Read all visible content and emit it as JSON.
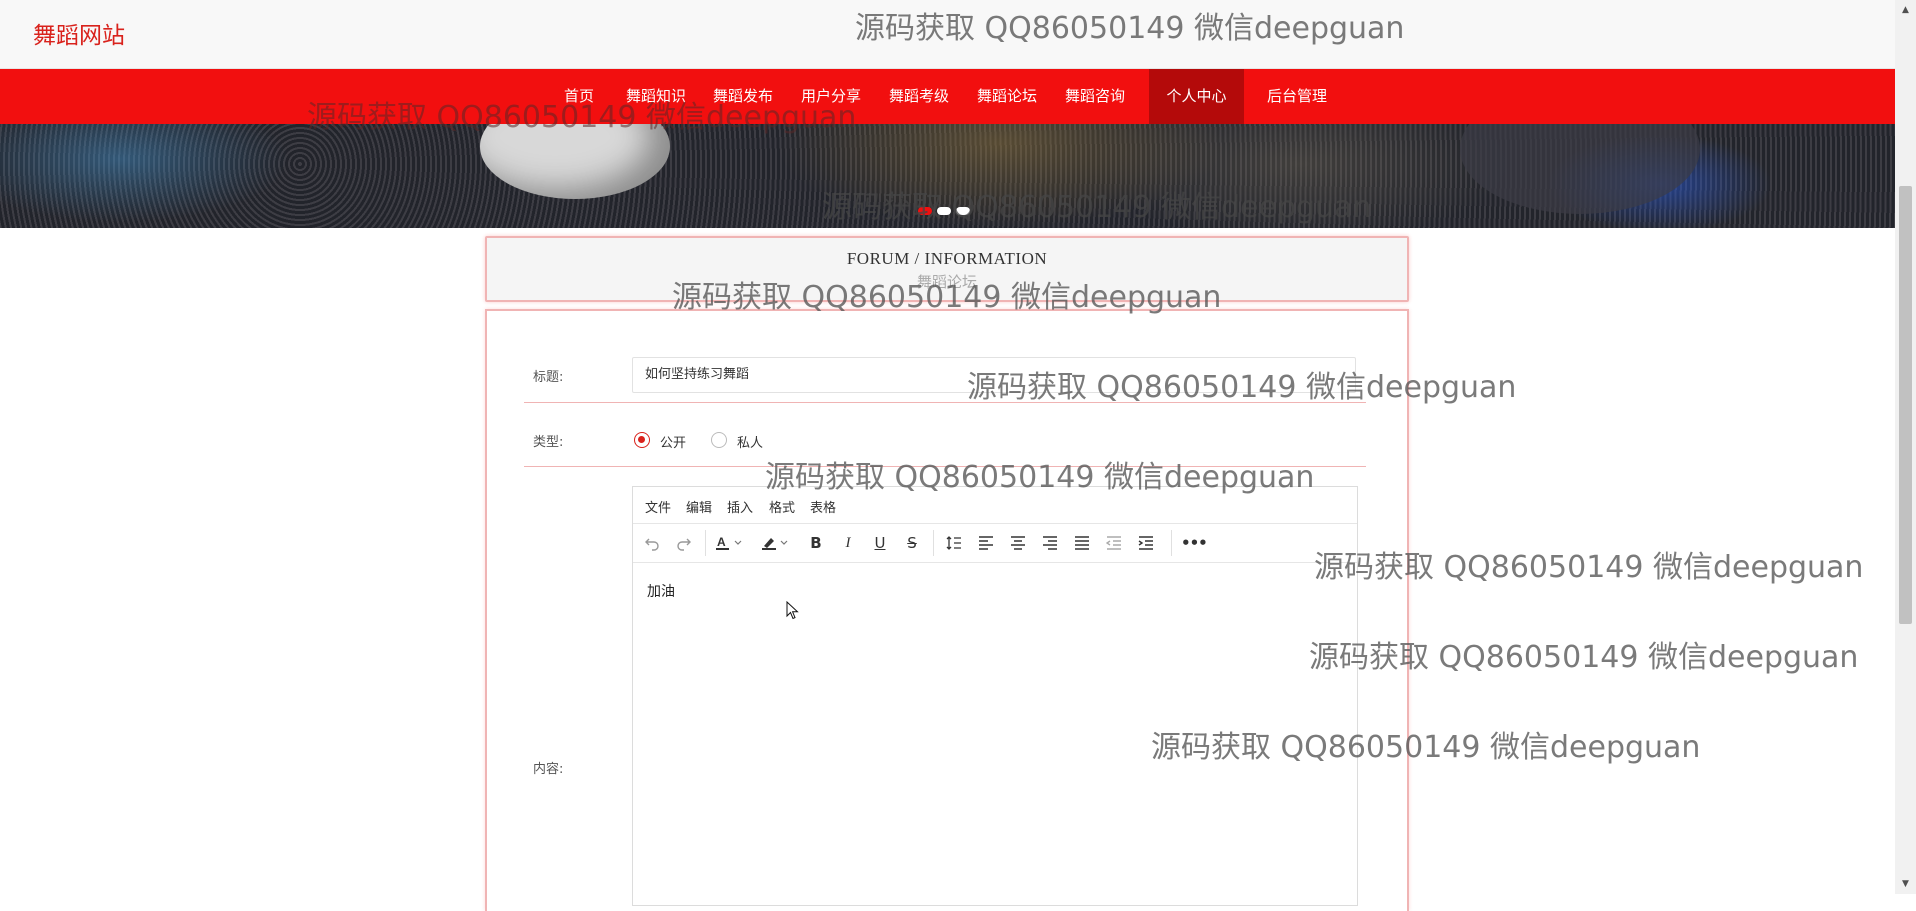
{
  "site": {
    "logo": "舞蹈网站"
  },
  "nav": {
    "items": [
      {
        "label": "首页"
      },
      {
        "label": "舞蹈知识"
      },
      {
        "label": "舞蹈发布"
      },
      {
        "label": "用户分享"
      },
      {
        "label": "舞蹈考级"
      },
      {
        "label": "舞蹈论坛"
      },
      {
        "label": "舞蹈咨询"
      },
      {
        "label": "个人中心",
        "active": true
      },
      {
        "label": "后台管理"
      }
    ],
    "background": "#f20f0f",
    "active_background": "#b40a0a"
  },
  "banner": {
    "slide_count": 3,
    "active_slide": 1
  },
  "section": {
    "title_en": "FORUM / INFORMATION",
    "title_cn": "舞蹈论坛"
  },
  "form": {
    "title_label": "标题:",
    "title_value": "如何坚持练习舞蹈",
    "type_label": "类型:",
    "type_options": [
      {
        "label": "公开",
        "selected": true
      },
      {
        "label": "私人",
        "selected": false
      }
    ],
    "content_label": "内容:"
  },
  "editor": {
    "menu": [
      "文件",
      "编辑",
      "插入",
      "格式",
      "表格"
    ],
    "toolbar_icons": [
      "undo-icon",
      "redo-icon",
      "text-color-icon",
      "highlight-icon",
      "bold-icon",
      "italic-icon",
      "underline-icon",
      "strikethrough-icon",
      "line-height-icon",
      "align-left-icon",
      "align-center-icon",
      "align-right-icon",
      "align-justify-icon",
      "outdent-icon",
      "indent-icon",
      "more-icon"
    ],
    "content": "加油"
  },
  "watermark": {
    "text": "源码获取 QQ86050149 微信deepguan"
  },
  "colors": {
    "accent": "#d9221c",
    "card_border": "#f0b4b4"
  }
}
